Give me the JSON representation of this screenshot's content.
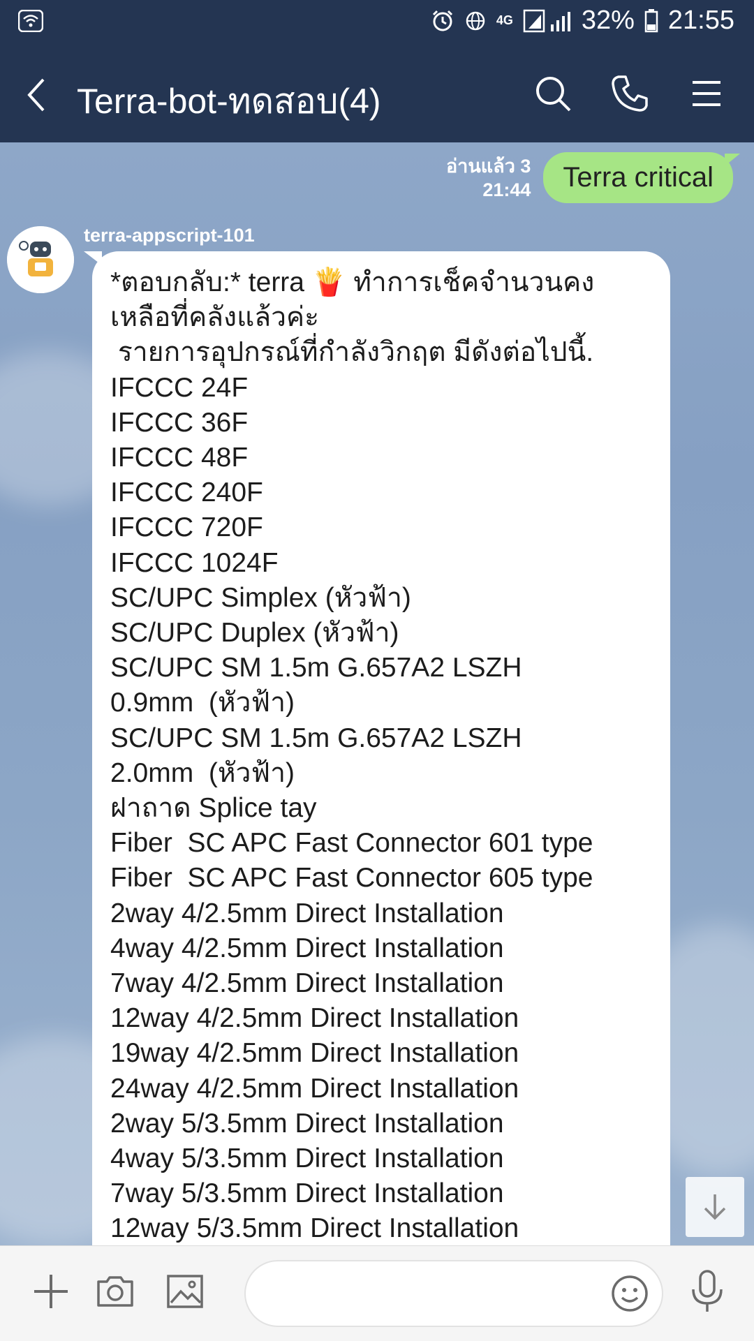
{
  "status_bar": {
    "network": "4G",
    "battery": "32%",
    "time": "21:55"
  },
  "header": {
    "title": "Terra-bot-ทดสอบ(4)",
    "icons": [
      "back-icon",
      "search-icon",
      "phone-icon",
      "menu-icon"
    ]
  },
  "outgoing": {
    "read_status": "อ่านแล้ว 3",
    "time": "21:44",
    "text": "Terra critical",
    "bubble_color": "#a6e585"
  },
  "incoming": {
    "sender": "terra-appscript-101",
    "lines": [
      "*ตอบกลับ:* terra 🍟 ทำการเช็คจำนวนคง",
      "เหลือที่คลังแล้วค่ะ",
      " รายการอุปกรณ์ที่กำลังวิกฤต มีดังต่อไปนี้.",
      "IFCCC 24F",
      "IFCCC 36F",
      "IFCCC 48F",
      "IFCCC 240F",
      "IFCCC 720F",
      "IFCCC 1024F",
      "SC/UPC Simplex (หัวฟ้า)",
      "SC/UPC Duplex (หัวฟ้า)",
      "SC/UPC SM 1.5m G.657A2 LSZH",
      "0.9mm  (หัวฟ้า)",
      "SC/UPC SM 1.5m G.657A2 LSZH",
      "2.0mm  (หัวฟ้า)",
      "ฝาถาด Splice tay",
      "Fiber  SC APC Fast Connector 601 type",
      "Fiber  SC APC Fast Connector 605 type",
      "2way 4/2.5mm Direct Installation",
      "4way 4/2.5mm Direct Installation",
      "7way 4/2.5mm Direct Installation",
      "12way 4/2.5mm Direct Installation",
      "19way 4/2.5mm Direct Installation",
      "24way 4/2.5mm Direct Installation",
      "2way 5/3.5mm Direct Installation",
      "4way 5/3.5mm Direct Installation",
      "7way 5/3.5mm Direct Installation",
      "12way 5/3.5mm Direct Installation"
    ]
  },
  "composer": {
    "value": "",
    "icons": [
      "plus-icon",
      "camera-icon",
      "image-icon",
      "emoji-icon",
      "mic-icon"
    ]
  },
  "colors": {
    "header_bg": "#243552",
    "chat_bg": "#8aa3c4"
  }
}
